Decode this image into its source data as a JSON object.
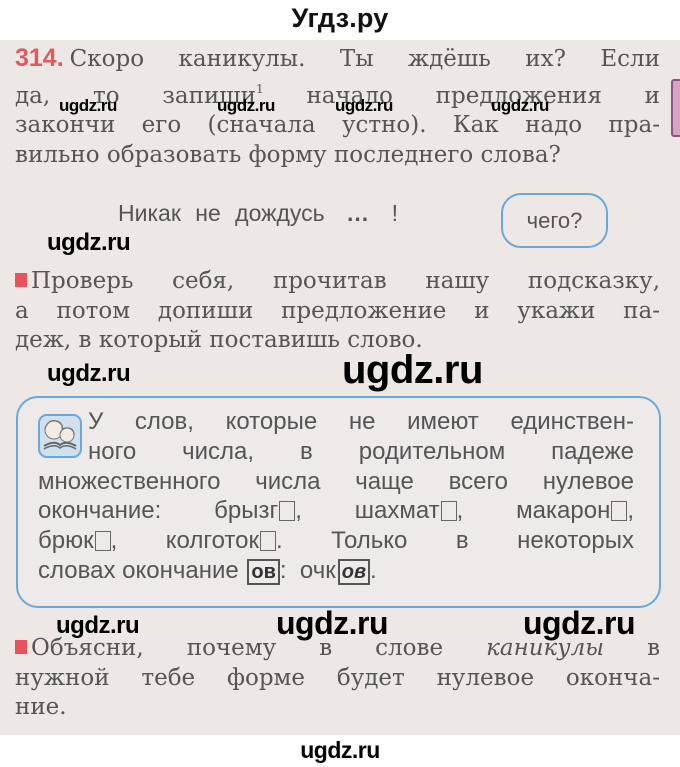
{
  "site": {
    "title": "Угдз.ру",
    "watermark": "ugdz.ru"
  },
  "exercise": {
    "number": "314.",
    "intro_lines": [
      "Скоро каникулы. Ты ждёшь их? Если",
      "да, то запиши",
      "начало предложения и",
      "закончи его (сначала устно). Как надо пра-",
      "вильно образовать форму последнего слова?"
    ],
    "footnote_mark": "1",
    "sentence": {
      "start": "Никак не дождусь",
      "dots": "...",
      "end": "!"
    },
    "question_bubble": "чего?",
    "task_check": {
      "lines": [
        "Проверь себя, прочитав нашу подсказку,",
        "а потом допиши предложение и укажи па-",
        "деж, в который поставишь слово."
      ]
    },
    "hint": {
      "icon": "children-reading-icon",
      "line1": "У слов, которые не имеют единствен-",
      "line2": "ного числа, в родительном падеже",
      "line3": "множественного числа чаще всего нулевое",
      "line4_prefix": "окончание:",
      "words_zero": [
        "брызг",
        "шахмат",
        "макарон",
        "брюк",
        "колготок"
      ],
      "line5_tail": "Только в некоторых",
      "line6_prefix": "словах окончание",
      "ending": "ов",
      "example_stem": "очк",
      "example_ending": "ов"
    },
    "task_explain": {
      "line1_prefix": "Объясни, почему в слове",
      "italic_word": "каникулы",
      "line1_suffix": "в",
      "line2": "нужной тебе форме будет нулевое оконча-",
      "line3": "ние."
    }
  },
  "colors": {
    "exercise_number": "#e05a5e",
    "marker": "#e8545a",
    "hint_border": "#6aa7da",
    "page_bg": "#ede8e6",
    "text": "#555555"
  }
}
